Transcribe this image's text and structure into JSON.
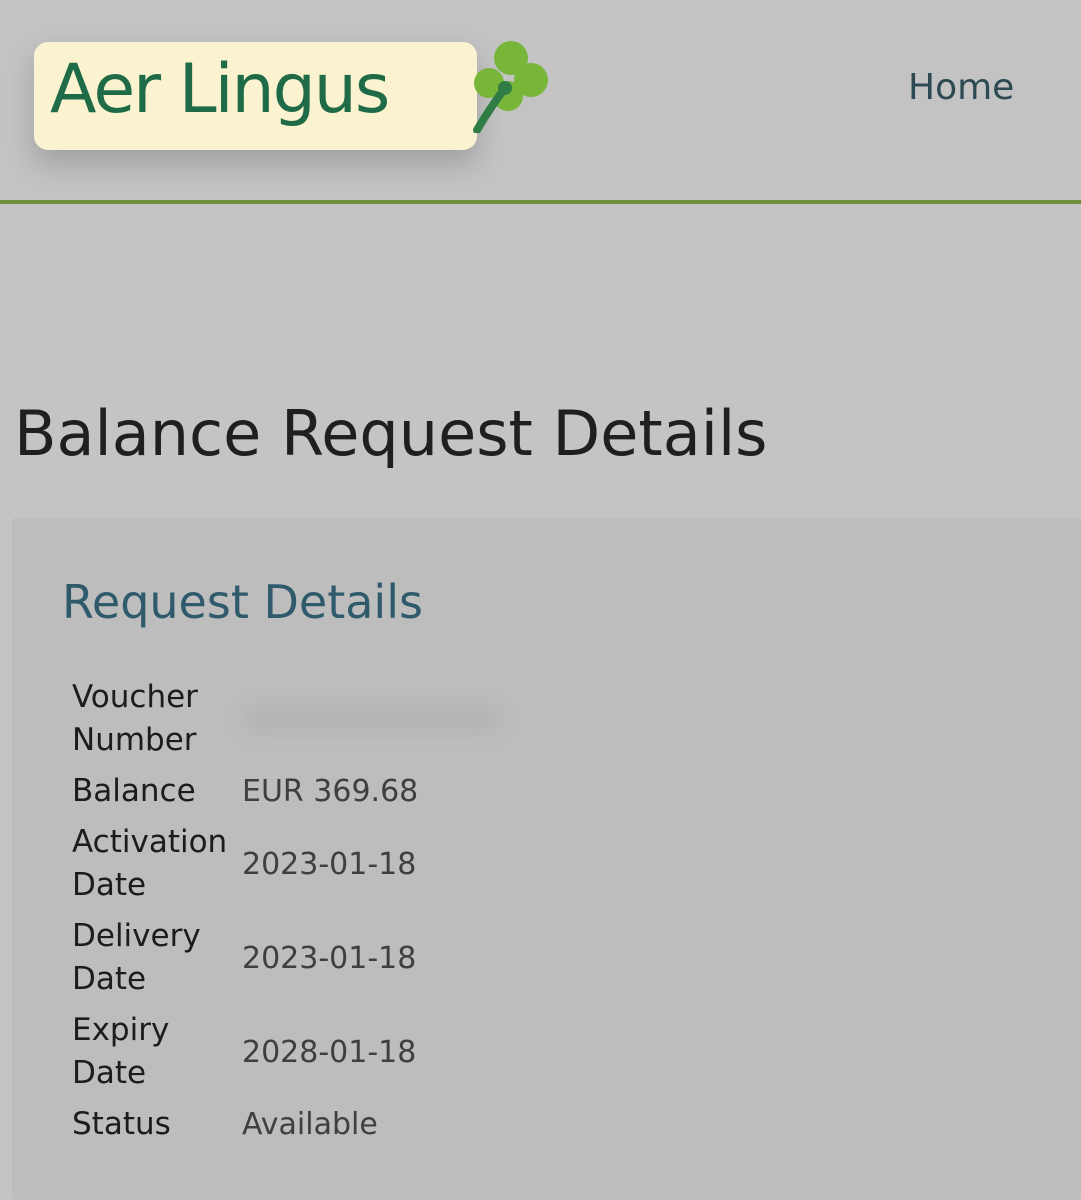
{
  "header": {
    "logo_text": "Aer Lingus",
    "nav": [
      {
        "label": "Home"
      }
    ]
  },
  "page": {
    "title": "Balance Request Details"
  },
  "card": {
    "title": "Request Details",
    "rows": [
      {
        "label": "Voucher Number",
        "value": ""
      },
      {
        "label": "Balance",
        "value": "EUR 369.68"
      },
      {
        "label": "Activation Date",
        "value": "2023-01-18"
      },
      {
        "label": "Delivery Date",
        "value": "2023-01-18"
      },
      {
        "label": "Expiry Date",
        "value": "2028-01-18"
      },
      {
        "label": "Status",
        "value": "Available"
      }
    ]
  },
  "theme": {
    "brand_green": "#1f6b47",
    "header_rule": "#6f8d3f",
    "logo_bg": "#fbf3cf"
  }
}
